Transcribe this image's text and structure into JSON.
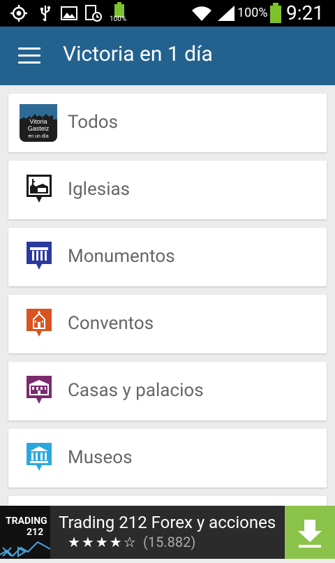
{
  "status_bar": {
    "battery_small": "100%",
    "battery": "100%",
    "time": "9:21",
    "icons": [
      "gps-icon",
      "usb-icon",
      "image-icon",
      "screenshot-icon",
      "battery-charging-icon",
      "wifi-icon",
      "signal-icon",
      "battery-icon"
    ]
  },
  "app_bar": {
    "title": "Victoria en 1 día",
    "color": "#23628f"
  },
  "categories": [
    {
      "label": "Todos",
      "icon": "vitoria-gasteiz-logo-icon",
      "logo_text": [
        "Vitoria",
        "Gasteiz",
        "en un día"
      ]
    },
    {
      "label": "Iglesias",
      "icon": "church-icon",
      "color": "#1a1a1a"
    },
    {
      "label": "Monumentos",
      "icon": "monument-icon",
      "color": "#2b3a9e"
    },
    {
      "label": "Conventos",
      "icon": "convent-icon",
      "color": "#d9531e"
    },
    {
      "label": "Casas y palacios",
      "icon": "palace-icon",
      "color": "#7b2a6e"
    },
    {
      "label": "Museos",
      "icon": "museum-icon",
      "color": "#29a8e0"
    }
  ],
  "ad": {
    "logo_line1": "TRADING",
    "logo_line2": "212",
    "title": "Trading 212 Forex y acciones",
    "rating": 4,
    "rating_stars": "★★★★☆",
    "reviews": "(15.882)",
    "download_color": "#8bc34a"
  }
}
